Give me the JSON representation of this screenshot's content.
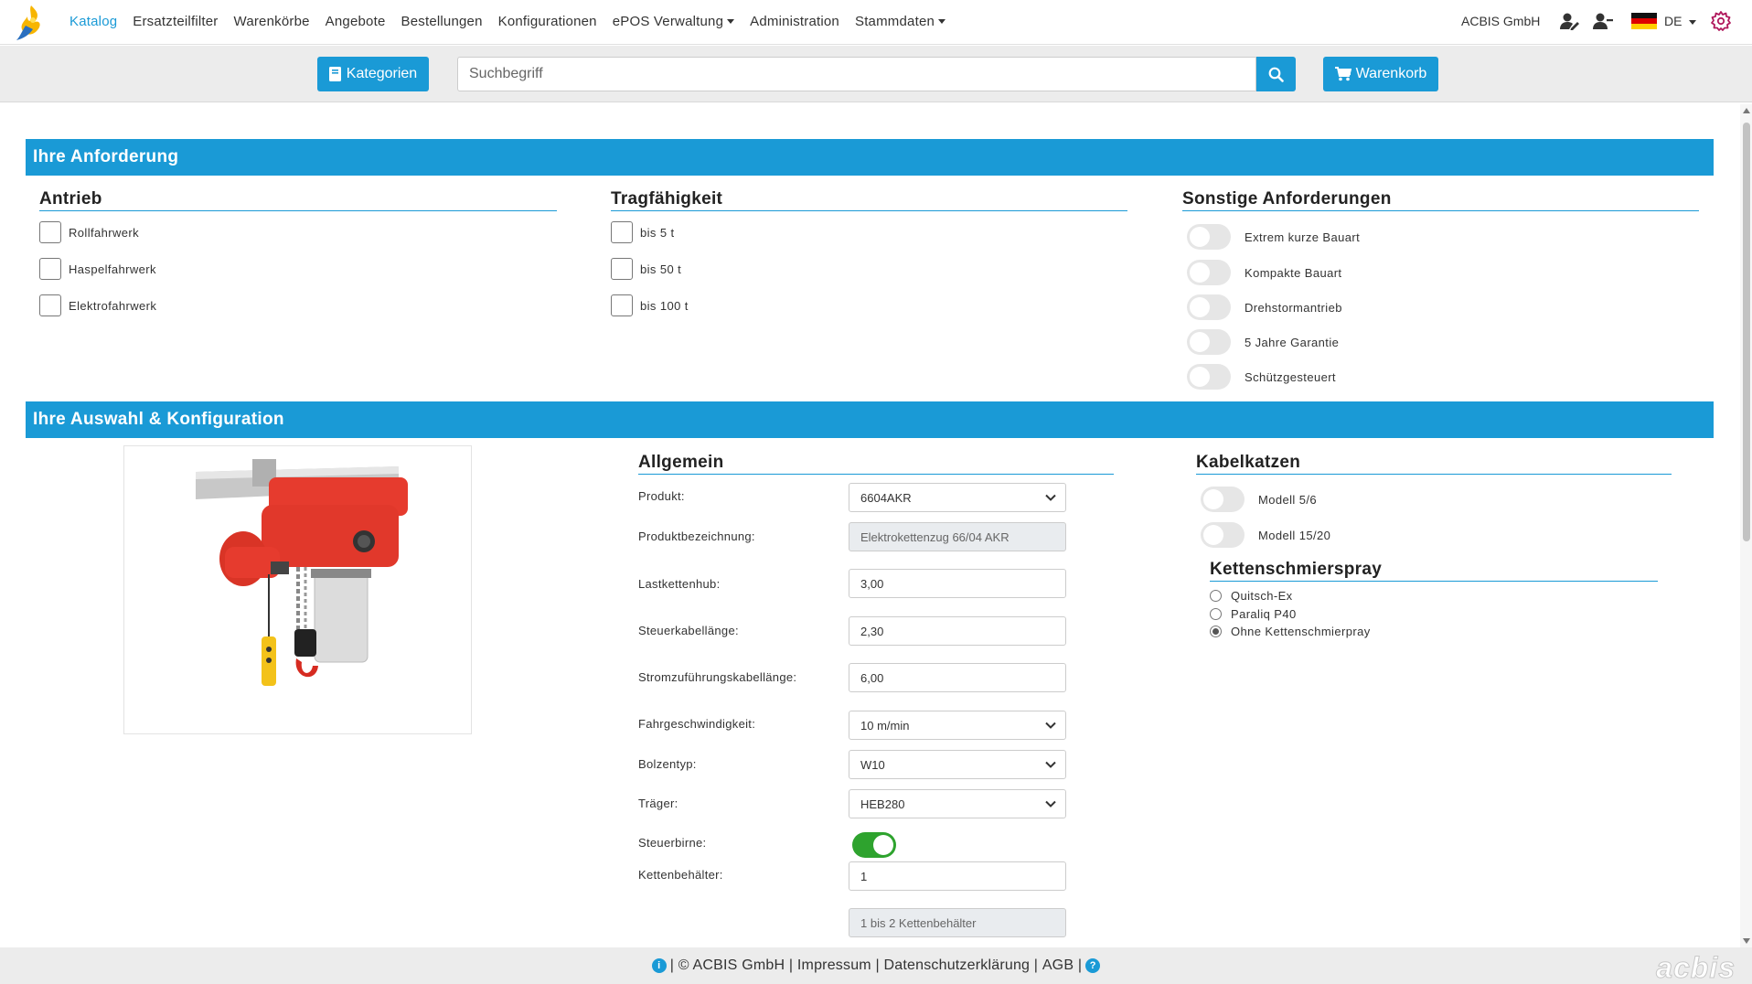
{
  "nav": {
    "items": [
      {
        "label": "Katalog",
        "active": true,
        "dropdown": false
      },
      {
        "label": "Ersatzteilfilter",
        "active": false,
        "dropdown": false
      },
      {
        "label": "Warenkörbe",
        "active": false,
        "dropdown": false
      },
      {
        "label": "Angebote",
        "active": false,
        "dropdown": false
      },
      {
        "label": "Bestellungen",
        "active": false,
        "dropdown": false
      },
      {
        "label": "Konfigurationen",
        "active": false,
        "dropdown": false
      },
      {
        "label": "ePOS Verwaltung",
        "active": false,
        "dropdown": true
      },
      {
        "label": "Administration",
        "active": false,
        "dropdown": false
      },
      {
        "label": "Stammdaten",
        "active": false,
        "dropdown": true
      }
    ],
    "company": "ACBIS GmbH",
    "language": "DE"
  },
  "search": {
    "categories_label": "Kategorien",
    "placeholder": "Suchbegriff",
    "cart_label": "Warenkorb"
  },
  "requirements": {
    "title": "Ihre Anforderung",
    "antrieb": {
      "title": "Antrieb",
      "options": [
        {
          "label": "Rollfahrwerk",
          "checked": false
        },
        {
          "label": "Haspelfahrwerk",
          "checked": false
        },
        {
          "label": "Elektrofahrwerk",
          "checked": false
        }
      ]
    },
    "tragfaehigkeit": {
      "title": "Tragfähigkeit",
      "options": [
        {
          "label": "bis 5 t",
          "checked": false
        },
        {
          "label": "bis 50 t",
          "checked": false
        },
        {
          "label": "bis 100 t",
          "checked": false
        }
      ]
    },
    "sonstige": {
      "title": "Sonstige Anforderungen",
      "options": [
        {
          "label": "Extrem kurze Bauart",
          "on": false
        },
        {
          "label": "Kompakte Bauart",
          "on": false
        },
        {
          "label": "Drehstormantrieb",
          "on": false
        },
        {
          "label": "5 Jahre Garantie",
          "on": false
        },
        {
          "label": "Schützgesteuert",
          "on": false
        }
      ]
    }
  },
  "config": {
    "title": "Ihre Auswahl & Konfiguration",
    "allgemein": {
      "title": "Allgemein",
      "fields": [
        {
          "label": "Produkt:",
          "value": "6604AKR",
          "type": "select"
        },
        {
          "label": "Produktbezeichnung:",
          "value": "Elektrokettenzug 66/04 AKR",
          "type": "readonly"
        },
        {
          "label": "Lastkettenhub:",
          "value": "3,00",
          "type": "input"
        },
        {
          "label": "Steuerkabellänge:",
          "value": "2,30",
          "type": "input"
        },
        {
          "label": "Stromzuführungskabellänge:",
          "value": "6,00",
          "type": "input"
        },
        {
          "label": "Fahrgeschwindigkeit:",
          "value": "10 m/min",
          "type": "select"
        },
        {
          "label": "Bolzentyp:",
          "value": "W10",
          "type": "select"
        },
        {
          "label": "Träger:",
          "value": "HEB280",
          "type": "select"
        }
      ],
      "steuerbirne_label": "Steuerbirne:",
      "steuerbirne_on": true,
      "kettenbehaelter_label": "Kettenbehälter:",
      "kettenbehaelter_value": "1",
      "kettenbehaelter_hint": "1 bis 2 Kettenbehälter"
    },
    "kabelkatzen": {
      "title": "Kabelkatzen",
      "options": [
        {
          "label": "Modell 5/6",
          "on": false
        },
        {
          "label": "Modell 15/20",
          "on": false
        }
      ]
    },
    "kettenschmierspray": {
      "title": "Kettenschmierspray",
      "options": [
        {
          "label": "Quitsch-Ex",
          "selected": false
        },
        {
          "label": "Paraliq P40",
          "selected": false
        },
        {
          "label": "Ohne Kettenschmierpray",
          "selected": true
        }
      ]
    }
  },
  "footer": {
    "copyright": "| © ACBIS GmbH |",
    "impressum": "Impressum",
    "sep1": "|",
    "datenschutz": "Datenschutzerklärung",
    "sep2": "|",
    "agb": "AGB",
    "sep3": "|",
    "brand": "acbis"
  },
  "colors": {
    "accent": "#1a9ad6",
    "toggle_on": "#2ea32e"
  }
}
